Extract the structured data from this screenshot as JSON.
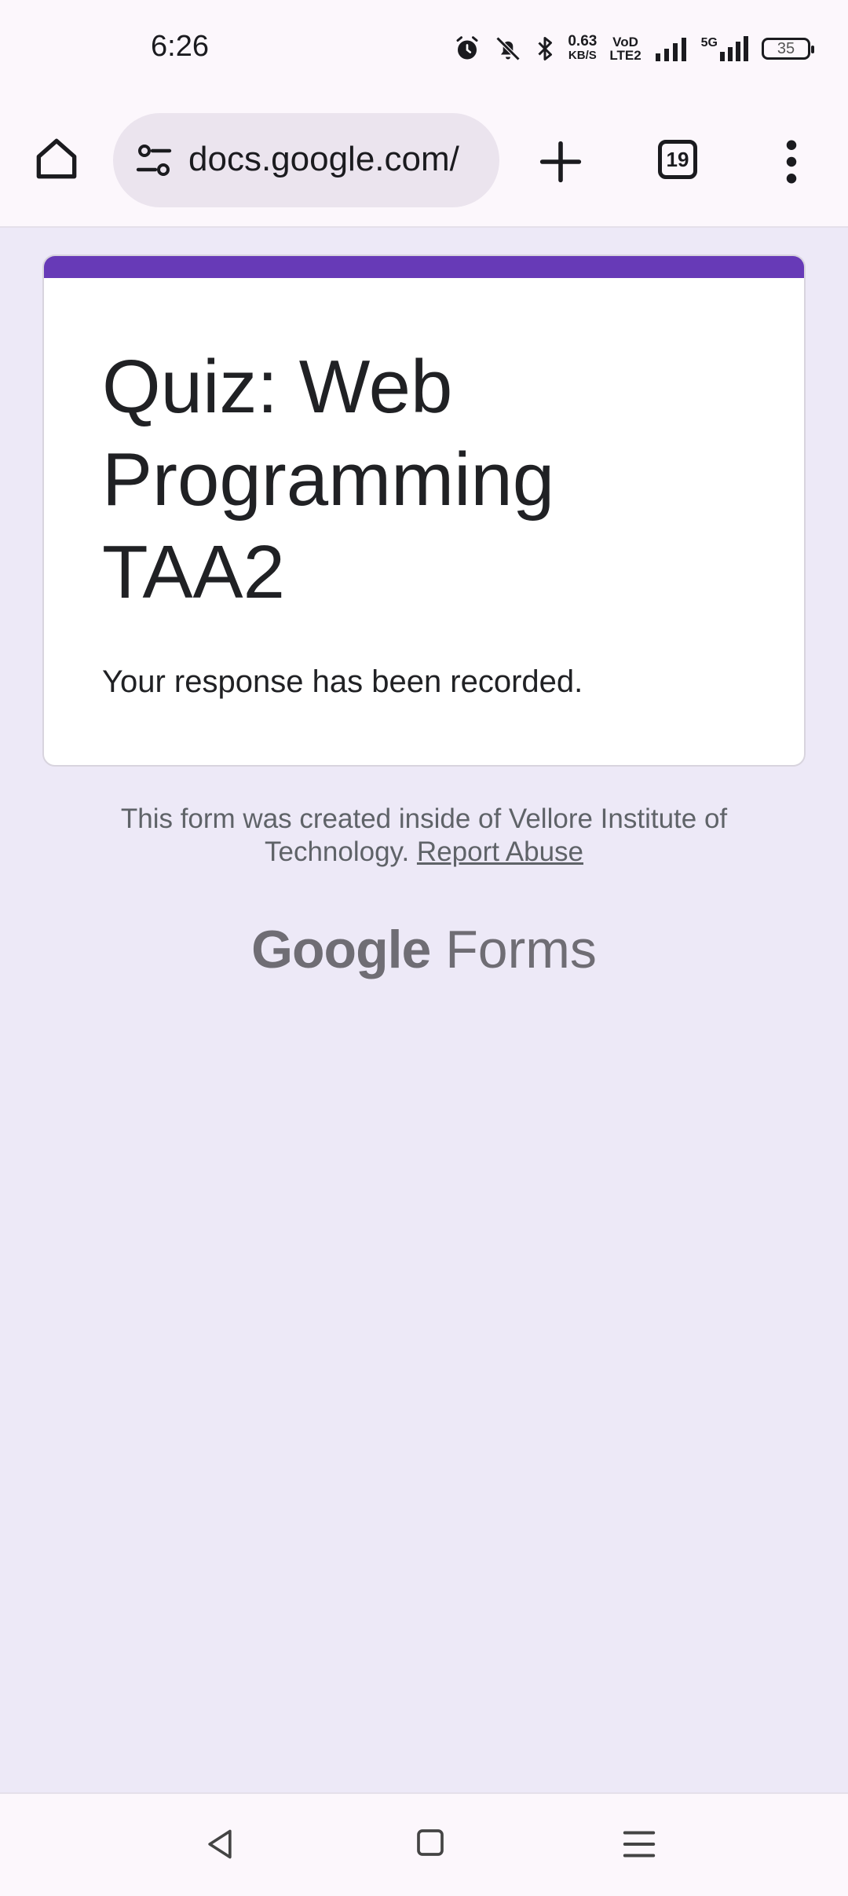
{
  "status_bar": {
    "time": "6:26",
    "net_speed_value": "0.63",
    "net_speed_unit": "KB/S",
    "volte_line1": "VoD",
    "volte_line2": "LTE2",
    "network_5g": "5G",
    "battery_level": "35"
  },
  "browser": {
    "url": "docs.google.com/",
    "tab_count": "19"
  },
  "form": {
    "accent_color": "#673ab7",
    "title": "Quiz: Web Programming TAA2",
    "confirmation": "Your response has been recorded."
  },
  "footer": {
    "note_text": "This form was created inside of Vellore Institute of Technology.",
    "report_link": "Report Abuse",
    "brand_google": "Google",
    "brand_forms": "Forms"
  }
}
